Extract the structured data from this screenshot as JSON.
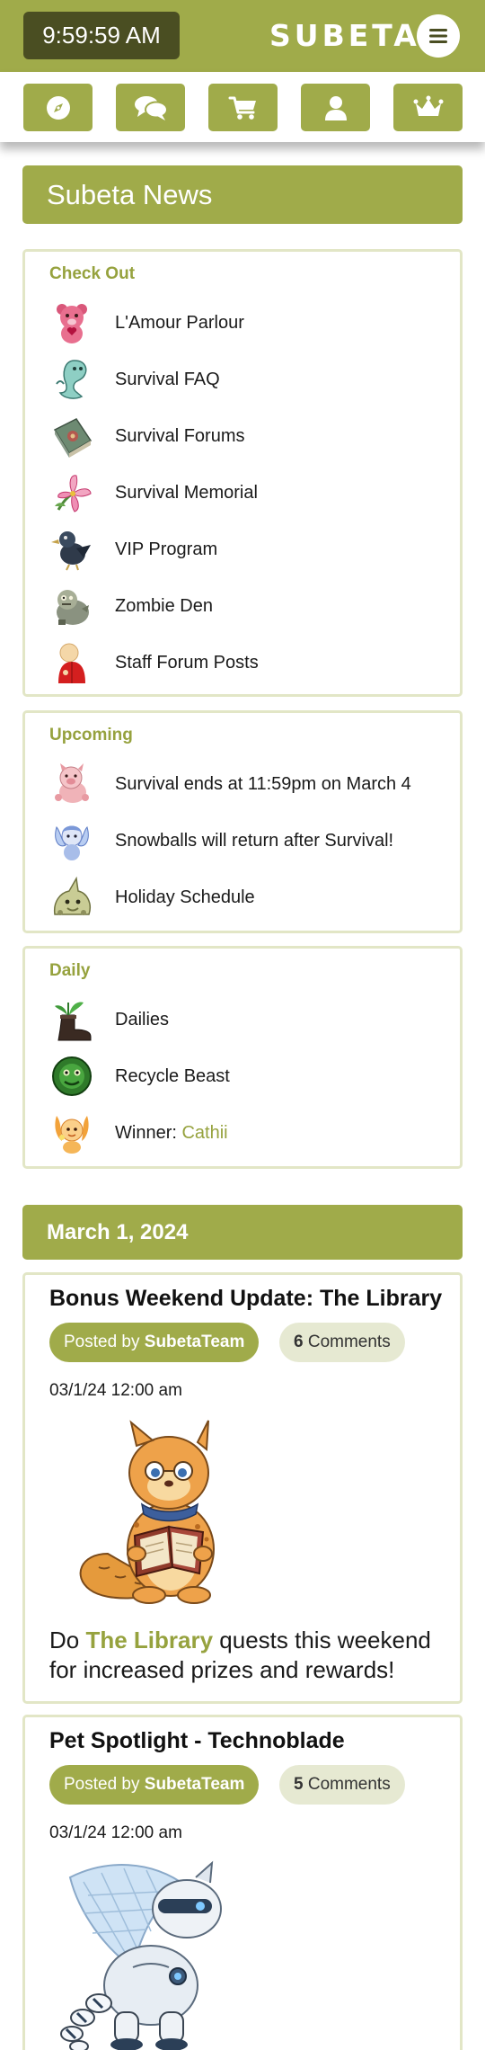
{
  "header": {
    "clock": "9:59:59 AM",
    "brand": "SUBETA",
    "menu_icon": "hamburger-icon"
  },
  "nav": {
    "buttons": [
      {
        "icon": "compass-icon"
      },
      {
        "icon": "chat-bubbles-icon"
      },
      {
        "icon": "shopping-cart-icon"
      },
      {
        "icon": "user-icon"
      },
      {
        "icon": "crown-icon"
      }
    ]
  },
  "news_header": "Subeta News",
  "sections": [
    {
      "title": "Check Out",
      "items": [
        {
          "icon": "pink-bear-icon",
          "label": "L'Amour Parlour"
        },
        {
          "icon": "ghost-creature-icon",
          "label": "Survival FAQ"
        },
        {
          "icon": "book-icon",
          "label": "Survival Forums"
        },
        {
          "icon": "lily-flower-icon",
          "label": "Survival Memorial"
        },
        {
          "icon": "crow-icon",
          "label": "VIP Program"
        },
        {
          "icon": "zombie-icon",
          "label": "Zombie Den"
        },
        {
          "icon": "staff-avatar-icon",
          "label": "Staff Forum Posts"
        }
      ]
    },
    {
      "title": "Upcoming",
      "items": [
        {
          "icon": "pink-pig-icon",
          "label": "Survival ends at 11:59pm on March 4"
        },
        {
          "icon": "snow-fairy-icon",
          "label": "Snowballs will return after Survival!"
        },
        {
          "icon": "green-blob-icon",
          "label": "Holiday Schedule"
        }
      ]
    },
    {
      "title": "Daily",
      "items": [
        {
          "icon": "boot-plant-icon",
          "label": "Dailies"
        },
        {
          "icon": "recycle-beast-icon",
          "label": "Recycle Beast"
        },
        {
          "icon": "orange-creature-icon",
          "label": "Winner: ",
          "highlight": "Cathii"
        }
      ]
    }
  ],
  "date_header": "March 1, 2024",
  "posts": [
    {
      "title": "Bonus Weekend Update: The Library",
      "posted_by_prefix": "Posted by ",
      "author": "SubetaTeam",
      "comment_count": "6",
      "comments_label": " Comments",
      "date": "03/1/24 12:00 am",
      "image": "reading-creature-illustration",
      "text_before": "Do ",
      "link_text": "The Library",
      "text_after": " quests this weekend for increased prizes and rewards!"
    },
    {
      "title": "Pet Spotlight - Technoblade",
      "posted_by_prefix": "Posted by ",
      "author": "SubetaTeam",
      "comment_count": "5",
      "comments_label": " Comments",
      "date": "03/1/24 12:00 am",
      "image": "robot-dragon-illustration"
    }
  ],
  "colors": {
    "brand_green": "#a0ab4a",
    "dark_olive": "#4a4e22",
    "accent_text": "#96a23e",
    "box_border": "#e2e6c6",
    "comment_pill": "#e6e9d2"
  }
}
